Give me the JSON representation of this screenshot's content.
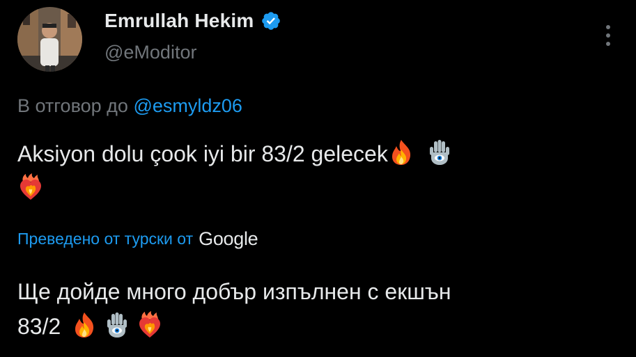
{
  "author": {
    "display_name": "Emrullah Hekim",
    "handle": "@eModitor",
    "verified": true
  },
  "reply": {
    "prefix": "В отговор до",
    "mention": "@esmyldz06"
  },
  "tweet": {
    "text": "Aksiyon dolu çook iyi bir 83/2 gelecek",
    "emojis": [
      "fire-icon",
      "hamsa-icon",
      "heart-on-fire-icon"
    ]
  },
  "translation": {
    "label": "Преведено от турски от",
    "provider": "Google",
    "line1": "Ще дойде много добър изпълнен с екшън",
    "line2": "83/2"
  },
  "colors": {
    "background": "#000000",
    "text": "#e7e9ea",
    "secondary": "#71767b",
    "link": "#1d9bf0"
  }
}
